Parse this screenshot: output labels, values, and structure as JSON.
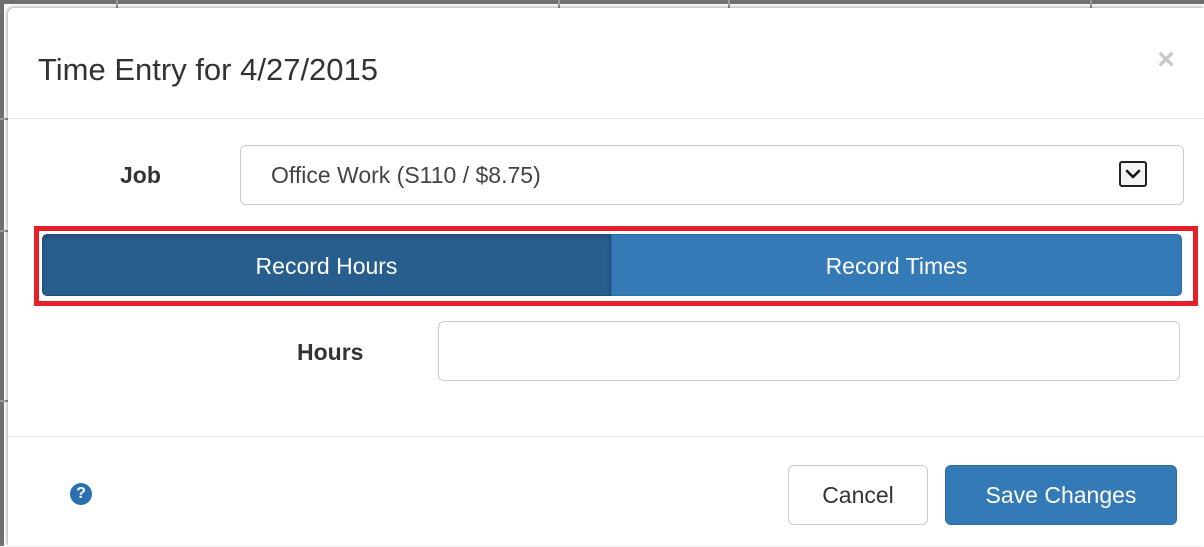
{
  "modal": {
    "title": "Time Entry for 4/27/2015",
    "close_glyph": "×",
    "close_icon": "close-icon"
  },
  "job": {
    "label": "Job",
    "selected": "Office Work (S110 / $8.75)",
    "arrow_icon": "chevron-down-icon"
  },
  "mode_toggle": {
    "options": [
      {
        "label": "Record Hours",
        "active": true
      },
      {
        "label": "Record Times",
        "active": false
      }
    ],
    "highlight_color": "#e5202b"
  },
  "hours": {
    "label": "Hours",
    "value": "",
    "placeholder": ""
  },
  "footer": {
    "help_glyph": "?",
    "help_icon": "question-circle-icon",
    "cancel_label": "Cancel",
    "save_label": "Save Changes"
  },
  "colors": {
    "primary": "#337ab7",
    "primary_active": "#285e8e",
    "help": "#2a6fb0"
  }
}
